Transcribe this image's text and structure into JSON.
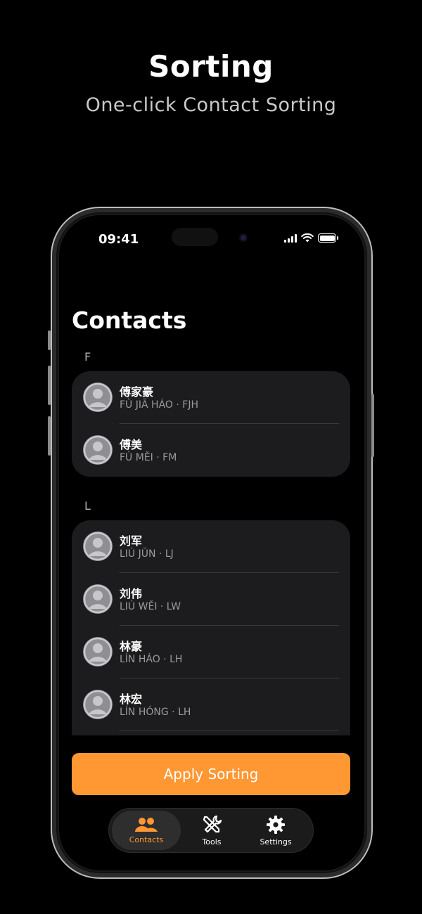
{
  "promo": {
    "title": "Sorting",
    "subtitle": "One-click Contact Sorting"
  },
  "status_bar": {
    "time": "09:41"
  },
  "page": {
    "title": "Contacts"
  },
  "sections": [
    {
      "letter": "F",
      "contacts": [
        {
          "name": "傅家豪",
          "pinyin": "FÙ JIĀ HÁO · FJH"
        },
        {
          "name": "傅美",
          "pinyin": "FÙ MĚI · FM"
        }
      ]
    },
    {
      "letter": "L",
      "contacts": [
        {
          "name": "刘军",
          "pinyin": "LIÚ JŪN · LJ"
        },
        {
          "name": "刘伟",
          "pinyin": "LIÚ WĚI · LW"
        },
        {
          "name": "林豪",
          "pinyin": "LÍN HÁO · LH"
        },
        {
          "name": "林宏",
          "pinyin": "LÍN HÓNG · LH"
        }
      ]
    }
  ],
  "actions": {
    "apply_label": "Apply Sorting"
  },
  "tabs": [
    {
      "label": "Contacts",
      "icon": "people-icon",
      "active": true
    },
    {
      "label": "Tools",
      "icon": "tools-icon",
      "active": false
    },
    {
      "label": "Settings",
      "icon": "gear-icon",
      "active": false
    }
  ],
  "colors": {
    "accent": "#ff9732",
    "card": "#1c1c1e",
    "background": "#000000"
  }
}
